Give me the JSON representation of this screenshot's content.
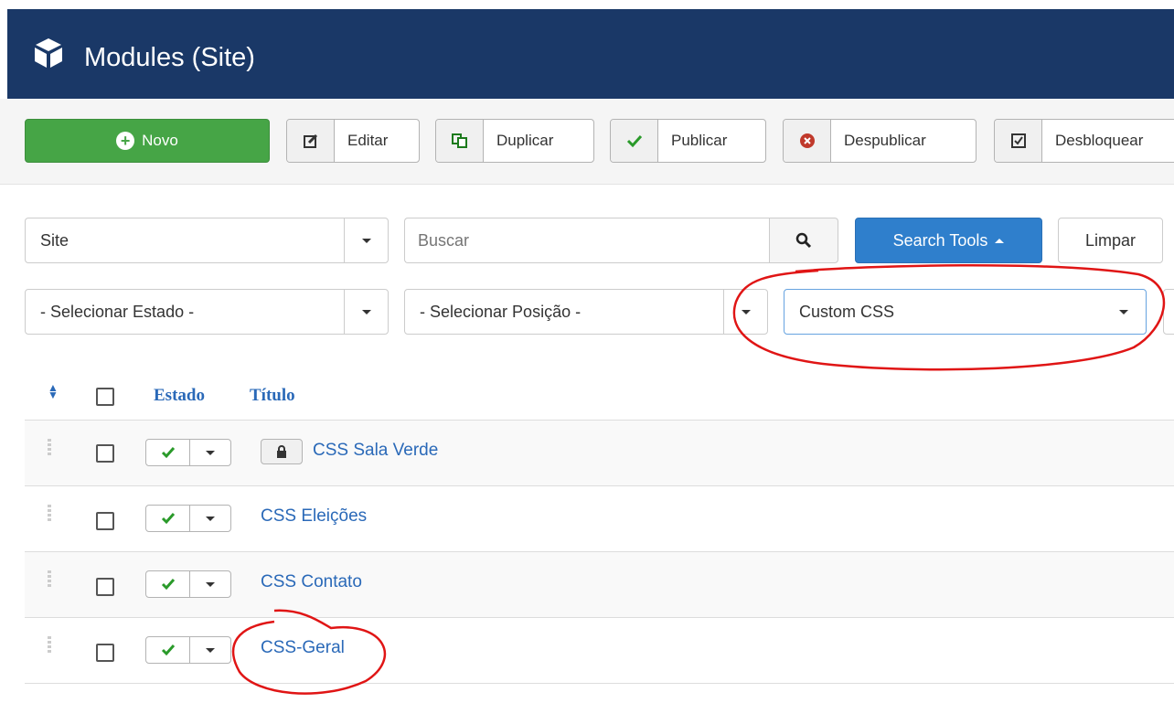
{
  "header": {
    "title": "Modules (Site)",
    "icon": "cube-icon"
  },
  "toolbar": {
    "new_label": "Novo",
    "edit_label": "Editar",
    "duplicate_label": "Duplicar",
    "publish_label": "Publicar",
    "unpublish_label": "Despublicar",
    "unlock_label": "Desbloquear"
  },
  "filters": {
    "client_value": "Site",
    "search_placeholder": "Buscar",
    "search_tools_label": "Search Tools",
    "clear_label": "Limpar",
    "state_value": "- Selecionar Estado -",
    "position_value": "- Selecionar Posição -",
    "type_value": "Custom CSS"
  },
  "table": {
    "col_status": "Estado",
    "col_title": "Título",
    "rows": [
      {
        "title": "CSS Sala Verde",
        "locked": true
      },
      {
        "title": "CSS Eleições",
        "locked": false
      },
      {
        "title": "CSS Contato",
        "locked": false
      },
      {
        "title": "CSS-Geral",
        "locked": false
      }
    ]
  },
  "colors": {
    "header_bg": "#1a3867",
    "accent": "#2f7fcc",
    "success": "#46a546",
    "link": "#2a69b8",
    "annotation": "#e01515"
  }
}
